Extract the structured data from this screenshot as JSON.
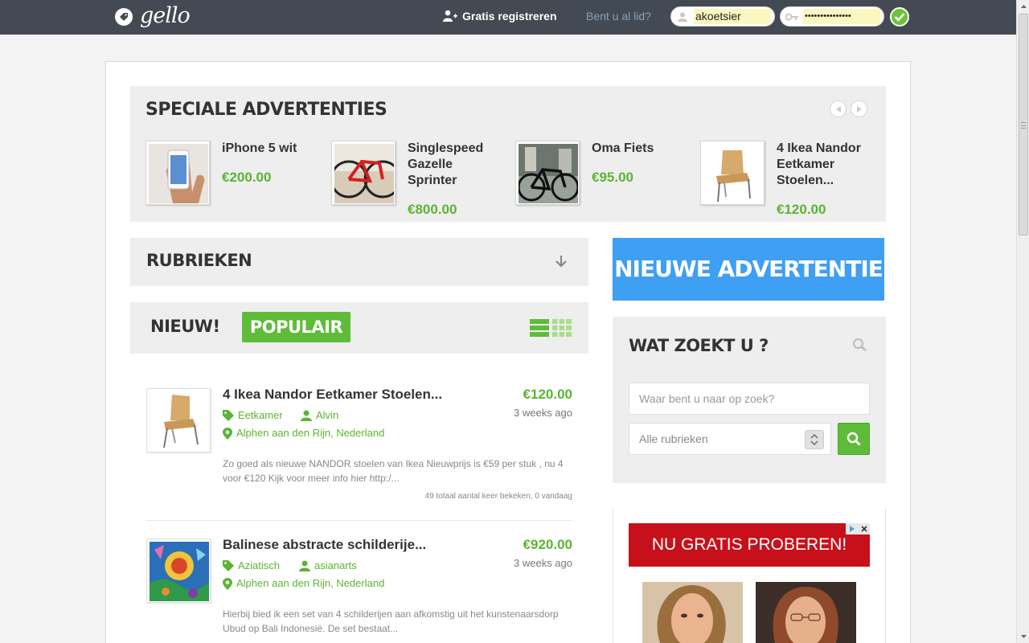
{
  "header": {
    "logo_text": "gello",
    "register_label": "Gratis registreren",
    "member_label": "Bent u al lid?",
    "username_value": "akoetsier",
    "password_value": "•••••••••••••••"
  },
  "special": {
    "title": "SPECIALE ADVERTENTIES",
    "items": [
      {
        "title": "iPhone 5 wit",
        "price": "€200.00"
      },
      {
        "title": "Singlespeed Gazelle Sprinter",
        "price": "€800.00"
      },
      {
        "title": "Oma Fiets",
        "price": "€95.00"
      },
      {
        "title": "4 Ikea Nandor Eetkamer Stoelen...",
        "price": "€120.00"
      }
    ]
  },
  "rubrieken": {
    "title": "RUBRIEKEN"
  },
  "tabs": {
    "new": "NIEUW!",
    "popular": "POPULAIR"
  },
  "listings": [
    {
      "title": "4 Ikea Nandor Eetkamer Stoelen...",
      "price": "€120.00",
      "age": "3 weeks ago",
      "category": "Eetkamer",
      "user": "Alvin",
      "location": "Alphen aan den Rijn, Nederland",
      "description": "Zo goed als nieuwe NANDOR stoelen van Ikea Nieuwprijs is €59 per stuk , nu 4 voor €120 Kijk voor meer info hier http:/...",
      "views": "49 totaal aantal keer bekeken, 0 vandaag"
    },
    {
      "title": "Balinese abstracte schilderije...",
      "price": "€920.00",
      "age": "3 weeks ago",
      "category": "Aziatisch",
      "user": "asianarts",
      "location": "Alphen aan den Rijn, Nederland",
      "description": "Hierbij bied ik een set van 4 schilderijen aan afkomstig uit het kunstenaarsdorp Ubud op Bali Indonesië. De set bestaat..."
    }
  ],
  "new_ad": {
    "label": "NIEUWE ADVERTENTIE"
  },
  "search": {
    "title": "WAT ZOEKT U ?",
    "placeholder": "Waar bent u naar op zoek?",
    "category_selected": "Alle rubrieken"
  },
  "ad": {
    "banner": "NU GRATIS PROBEREN!"
  },
  "colors": {
    "green": "#5fbc39",
    "blue": "#3f9ff2",
    "topbar": "#444a53",
    "ad_red": "#c8101a"
  }
}
